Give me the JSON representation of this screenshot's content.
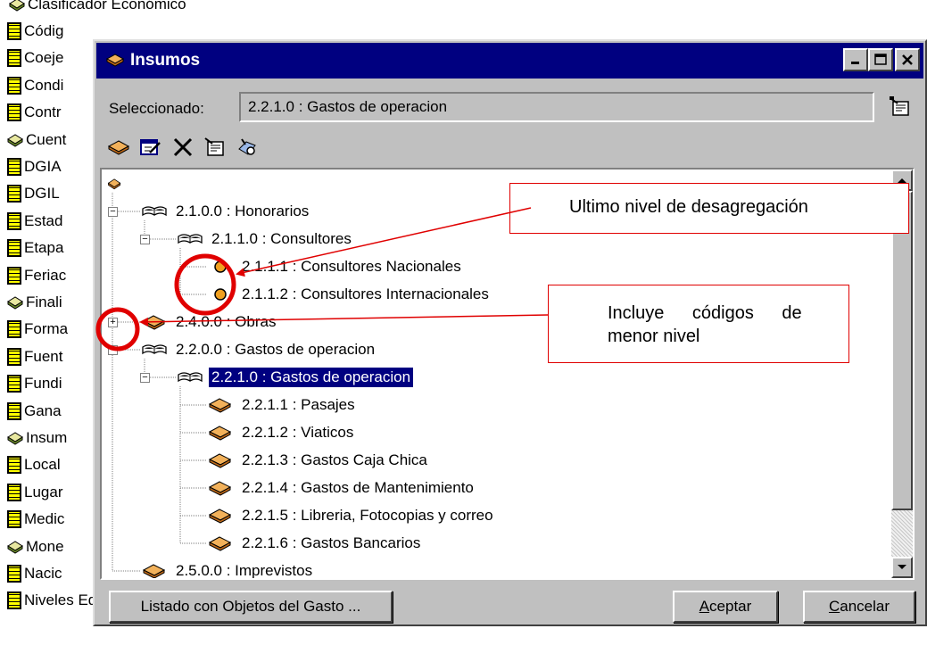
{
  "background_list": {
    "items": [
      {
        "label": "Clasificador Económico",
        "icon": "book-icon"
      },
      {
        "label": "Códig",
        "icon": "form-icon"
      },
      {
        "label": "Coeje",
        "icon": "form-icon"
      },
      {
        "label": "Condi",
        "icon": "form-icon"
      },
      {
        "label": "Contr",
        "icon": "form-icon"
      },
      {
        "label": "Cuent",
        "icon": "book-icon"
      },
      {
        "label": "DGIA",
        "icon": "form-icon"
      },
      {
        "label": "DGIL",
        "icon": "form-icon"
      },
      {
        "label": "Estad",
        "icon": "form-icon"
      },
      {
        "label": "Etapa",
        "icon": "form-icon"
      },
      {
        "label": "Feriac",
        "icon": "form-icon"
      },
      {
        "label": "Finali",
        "icon": "book-icon"
      },
      {
        "label": "Forma",
        "icon": "form-icon"
      },
      {
        "label": "Fuent",
        "icon": "form-icon"
      },
      {
        "label": "Fundi",
        "icon": "form-icon"
      },
      {
        "label": "Gana",
        "icon": "form-icon"
      },
      {
        "label": "Insum",
        "icon": "book-icon"
      },
      {
        "label": "Local",
        "icon": "form-icon"
      },
      {
        "label": "Lugar",
        "icon": "form-icon"
      },
      {
        "label": "Medic",
        "icon": "form-icon"
      },
      {
        "label": "Mone",
        "icon": "book-icon"
      },
      {
        "label": "Nacic",
        "icon": "form-icon"
      },
      {
        "label": "Niveles Educativos",
        "icon": "form-icon"
      }
    ]
  },
  "dialog": {
    "title": "Insumos",
    "title_icon": "book-icon",
    "window_buttons": [
      "minimize-icon",
      "maximize-icon",
      "close-icon"
    ],
    "selected_label": "Seleccionado:",
    "selected_value": "2.2.1.0 : Gastos de operacion",
    "properties_icon": "properties-icon",
    "toolbar": [
      "add-icon",
      "edit-icon",
      "delete-icon",
      "properties-icon",
      "lookup-icon"
    ]
  },
  "tree": {
    "nodes": [
      {
        "label": "",
        "icon": "root-book-icon",
        "level": 0
      },
      {
        "label": "2.1.0.0 : Honorarios",
        "icon": "open-book-icon",
        "level": 1,
        "expander": "minus"
      },
      {
        "label": "2.1.1.0 : Consultores",
        "icon": "open-book-icon",
        "level": 2,
        "expander": "minus"
      },
      {
        "label": "2.1.1.1 : Consultores Nacionales",
        "icon": "leaf-dot-icon",
        "level": 3
      },
      {
        "label": "2.1.1.2 : Consultores Internacionales",
        "icon": "leaf-dot-icon",
        "level": 3
      },
      {
        "label": "2.4.0.0 : Obras",
        "icon": "closed-book-icon",
        "level": 1,
        "expander": "plus"
      },
      {
        "label": "2.2.0.0 : Gastos de operacion",
        "icon": "open-book-icon",
        "level": 1,
        "expander": "minus"
      },
      {
        "label": "2.2.1.0 : Gastos de operacion",
        "icon": "open-book-icon",
        "level": 2,
        "expander": "minus",
        "selected": true
      },
      {
        "label": "2.2.1.1 : Pasajes",
        "icon": "closed-book-icon",
        "level": 3
      },
      {
        "label": "2.2.1.2 : Viaticos",
        "icon": "closed-book-icon",
        "level": 3
      },
      {
        "label": "2.2.1.3 : Gastos Caja Chica",
        "icon": "closed-book-icon",
        "level": 3
      },
      {
        "label": "2.2.1.4 : Gastos de Mantenimiento",
        "icon": "closed-book-icon",
        "level": 3
      },
      {
        "label": "2.2.1.5 : Libreria, Fotocopias y correo",
        "icon": "closed-book-icon",
        "level": 3
      },
      {
        "label": "2.2.1.6 : Gastos Bancarios",
        "icon": "closed-book-icon",
        "level": 3
      },
      {
        "label": "2.5.0.0 : Imprevistos",
        "icon": "closed-book-icon",
        "level": 1
      }
    ]
  },
  "buttons": {
    "list": "Listado con Objetos del Gasto ...",
    "accept_accel": "A",
    "accept_rest": "ceptar",
    "cancel_accel": "C",
    "cancel_rest": "ancelar"
  },
  "annotations": {
    "last_level": "Ultimo nivel de desagregación",
    "includes_line1": "Incluye códigos de",
    "includes_line2": "menor nivel",
    "color": "#e00000"
  },
  "colors": {
    "titlebar": "#000080",
    "face": "#c0c0c0",
    "book": "#e08a2a",
    "leaf_dot": "#f0a020"
  }
}
